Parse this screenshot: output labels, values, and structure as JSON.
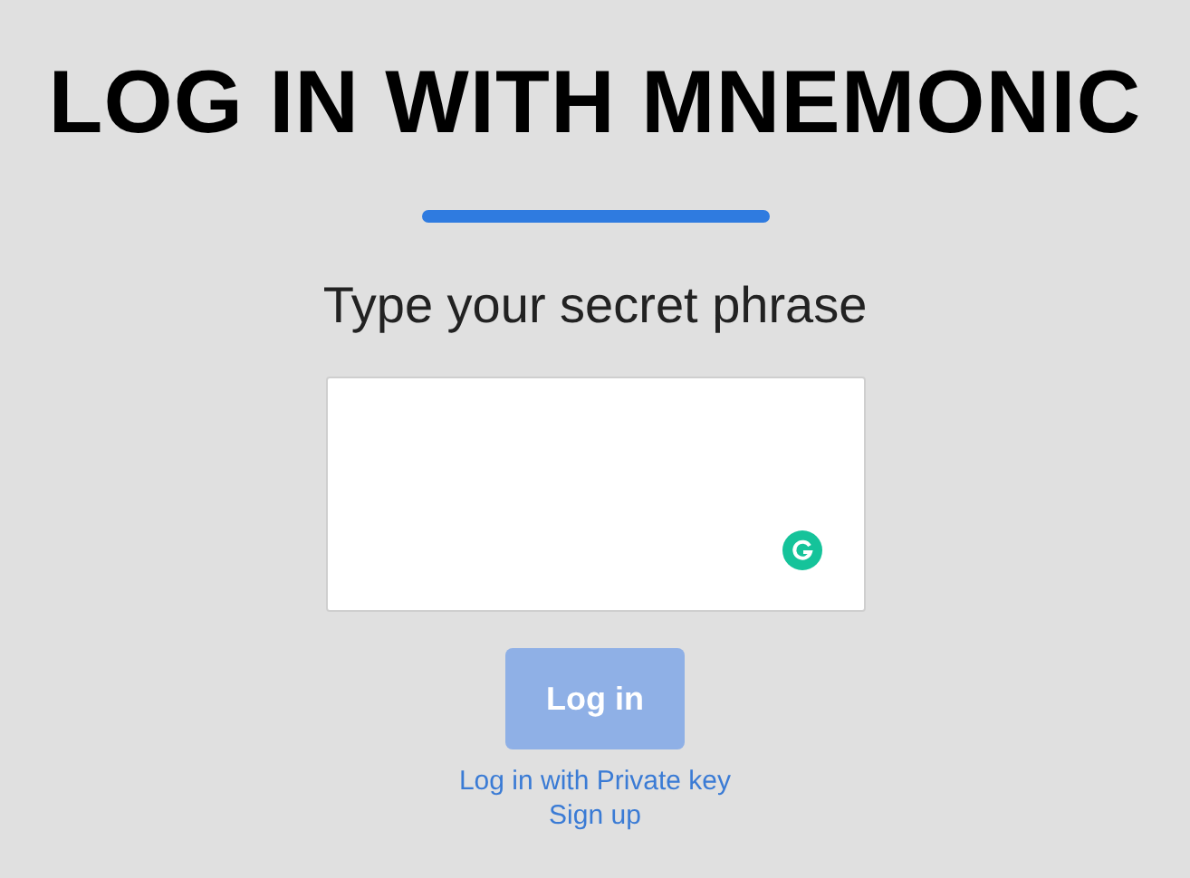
{
  "title": "LOG IN WITH MNEMONIC",
  "subtitle": "Type your secret phrase",
  "login_button": {
    "label": "Log in",
    "disabled": true
  },
  "links": [
    {
      "label": "Log in with Private key"
    },
    {
      "label": "Sign up"
    }
  ]
}
